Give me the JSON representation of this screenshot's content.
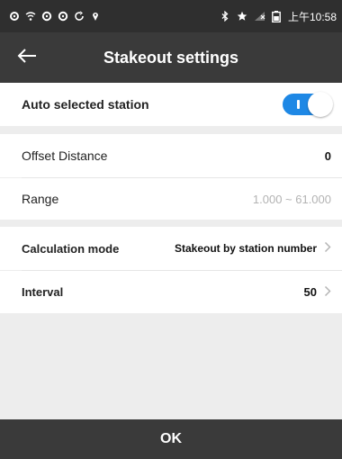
{
  "status_bar": {
    "time": "上午10:58",
    "icons": [
      "notification-icon",
      "wifi-icon",
      "sync-icon",
      "sync-icon",
      "alarm-icon",
      "location-icon",
      "bluetooth-icon",
      "star-icon",
      "no-signal-icon",
      "battery-icon"
    ]
  },
  "header": {
    "title": "Stakeout settings",
    "back_icon": "back-arrow-icon"
  },
  "settings": {
    "auto_station": {
      "label": "Auto selected station",
      "enabled": true
    },
    "offset_distance": {
      "label": "Offset Distance",
      "value": "0"
    },
    "range": {
      "label": "Range",
      "value": "1.000 ~ 61.000"
    },
    "calculation_mode": {
      "label": "Calculation mode",
      "value": "Stakeout by station number"
    },
    "interval": {
      "label": "Interval",
      "value": "50"
    }
  },
  "footer": {
    "ok_label": "OK"
  },
  "colors": {
    "toggle_on": "#1e88e5",
    "bar_background": "#3a3a3a",
    "page_background": "#ededed"
  }
}
